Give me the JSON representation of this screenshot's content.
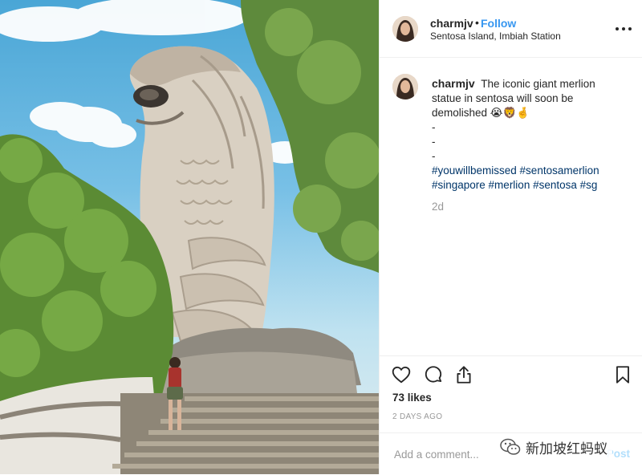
{
  "header": {
    "username": "charmjv",
    "separator": "•",
    "follow_label": "Follow",
    "location": "Sentosa Island, Imbiah Station"
  },
  "caption": {
    "username": "charmjv",
    "text": "The iconic giant merlion statue in sentosa will soon be demolished 😭🦁🤞",
    "dash_lines": [
      "-",
      "-",
      "-"
    ],
    "hashtags_line1": "#youwillbemissed #sentosamerlion",
    "hashtags_line2": "#singapore #merlion #sentosa #sg",
    "time_ago": "2d"
  },
  "actions": {
    "icons": [
      "heart-icon",
      "comment-icon",
      "share-icon",
      "bookmark-icon"
    ],
    "likes": "73 likes",
    "date": "2 DAYS AGO"
  },
  "add_comment": {
    "placeholder": "Add a comment...",
    "post_label": "Post"
  },
  "watermark": {
    "text": "新加坡红蚂蚁"
  },
  "colors": {
    "link_blue": "#3897f0",
    "hashtag": "#003569",
    "muted": "#999999",
    "post_disabled": "#b2dffc"
  }
}
